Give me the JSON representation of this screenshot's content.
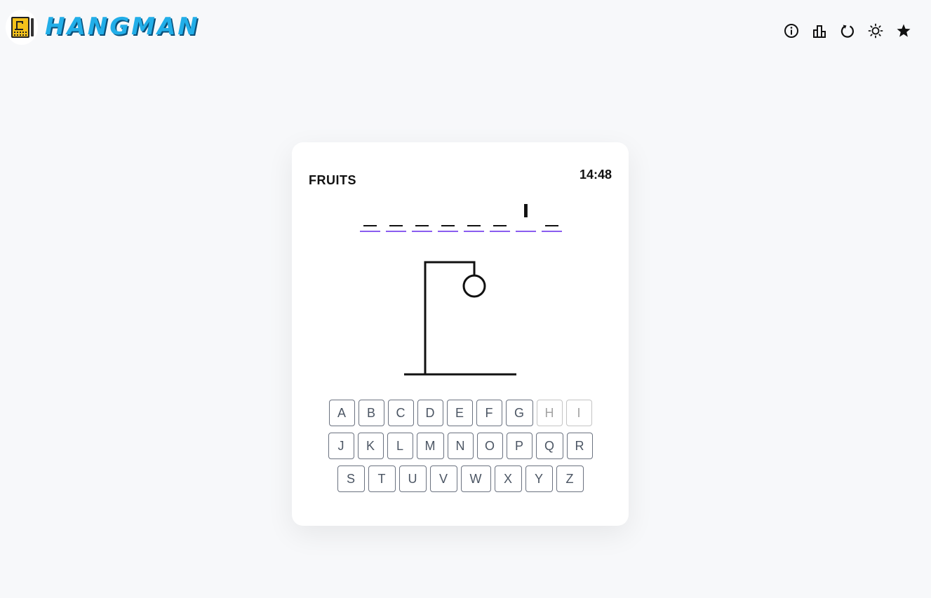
{
  "header": {
    "title": "HANGMAN",
    "icons": [
      "info-icon",
      "stats-icon",
      "restart-icon",
      "theme-sun-icon",
      "star-icon"
    ]
  },
  "game": {
    "category": "FRUITS",
    "timer": "14:48",
    "word_slots": [
      "",
      "",
      "",
      "",
      "",
      "",
      "I",
      ""
    ],
    "wrong_guesses": 1,
    "keyboard": {
      "rows": [
        [
          "A",
          "B",
          "C",
          "D",
          "E",
          "F",
          "G",
          "H",
          "I"
        ],
        [
          "J",
          "K",
          "L",
          "M",
          "N",
          "O",
          "P",
          "Q",
          "R"
        ],
        [
          "S",
          "T",
          "U",
          "V",
          "W",
          "X",
          "Y",
          "Z"
        ]
      ],
      "used_letters": [
        "H",
        "I"
      ]
    }
  },
  "colors": {
    "title": "#22aee8",
    "title_shadow": "#0b4f79",
    "slot_underline": "#8a5cf0",
    "logo": "#f4c21b"
  }
}
